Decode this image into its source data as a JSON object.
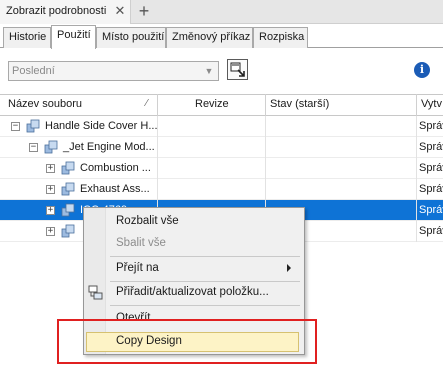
{
  "panel": {
    "title": "Zobrazit podrobnosti",
    "close_glyph": "✕",
    "add_glyph": "+"
  },
  "tabs": [
    {
      "label": "Historie"
    },
    {
      "label": "Použití",
      "active": true
    },
    {
      "label": "Místo použití"
    },
    {
      "label": "Změnový příkaz"
    },
    {
      "label": "Rozpiska"
    }
  ],
  "toolbar": {
    "version_select": "Poslední",
    "expand_icon": "expand-all-icon",
    "info_icon": "info-icon"
  },
  "grid": {
    "columns": [
      "Název souboru",
      "Revize",
      "Stav (starší)",
      "Vytv"
    ],
    "rows": [
      {
        "name": "Handle Side Cover H...",
        "state": "Správ",
        "level": 0,
        "expander": "−",
        "selected": false
      },
      {
        "name": "_Jet Engine Mod...",
        "state": "Správ",
        "level": 1,
        "expander": "−",
        "selected": false
      },
      {
        "name": "Combustion ...",
        "state": "Správ",
        "level": 2,
        "expander": "+",
        "selected": false
      },
      {
        "name": "Exhaust Ass...",
        "state": "Správ",
        "level": 2,
        "expander": "+",
        "selected": false
      },
      {
        "name": "ICC-4769",
        "state": "Správ",
        "level": 2,
        "expander": "+",
        "selected": true
      },
      {
        "name": "",
        "state": "Správ",
        "level": 2,
        "expander": "+",
        "selected": false
      }
    ]
  },
  "context_menu": {
    "items": [
      {
        "label": "Rozbalit vše",
        "enabled": true
      },
      {
        "label": "Sbalit vše",
        "enabled": false
      },
      {
        "label": "Přejít na",
        "enabled": true,
        "submenu": true
      },
      {
        "label": "Přiřadit/aktualizovat položku...",
        "enabled": true,
        "icon": "assign-item-icon"
      },
      {
        "label": "Otevřít",
        "enabled": true
      },
      {
        "label": "Copy Design",
        "enabled": true,
        "highlighted": true
      }
    ]
  },
  "colors": {
    "selection": "#0e73d6",
    "highlight_frame": "#e02020",
    "menu_hover": "#fdf3c6"
  }
}
